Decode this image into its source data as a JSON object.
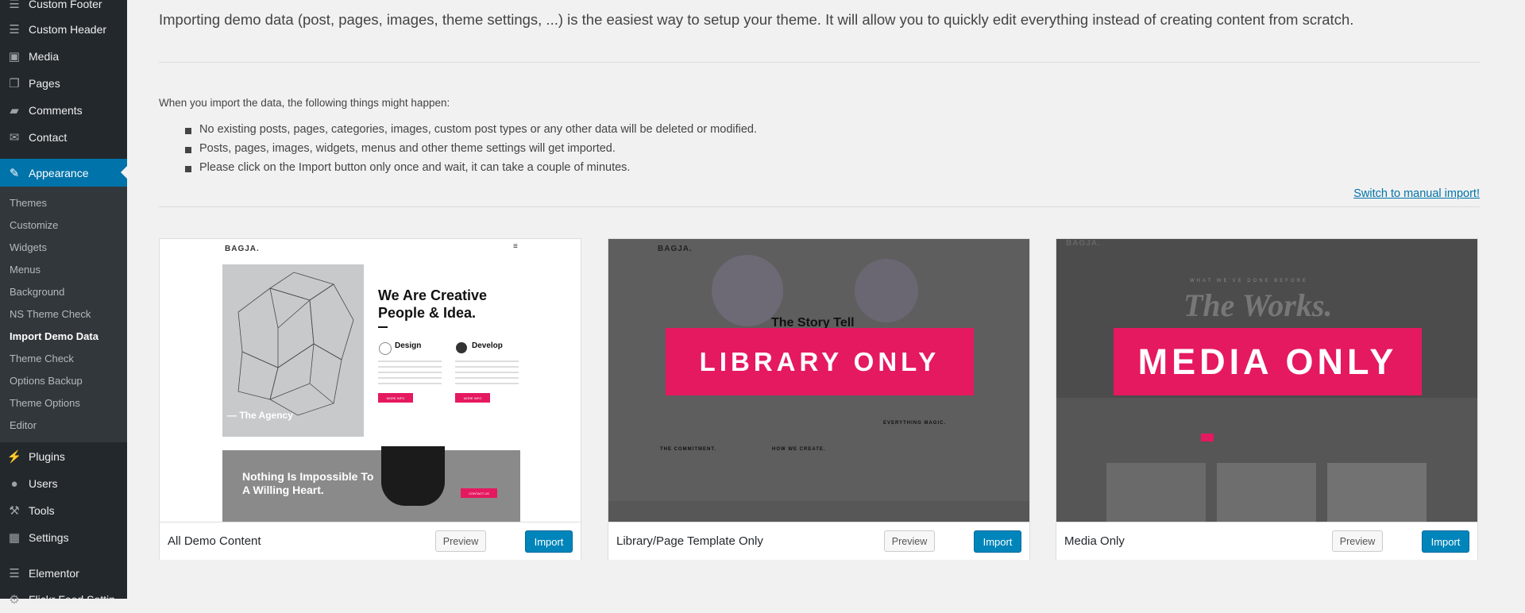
{
  "sidebar": {
    "items_top": [
      {
        "label": "Custom Footer",
        "icon": "menu-icon"
      },
      {
        "label": "Custom Header",
        "icon": "menu-icon"
      },
      {
        "label": "Media",
        "icon": "media-icon"
      },
      {
        "label": "Pages",
        "icon": "pages-icon"
      },
      {
        "label": "Comments",
        "icon": "comments-icon"
      },
      {
        "label": "Contact",
        "icon": "mail-icon"
      }
    ],
    "current": {
      "label": "Appearance",
      "icon": "paintbrush-icon"
    },
    "submenu": [
      "Themes",
      "Customize",
      "Widgets",
      "Menus",
      "Background",
      "NS Theme Check",
      "Import Demo Data",
      "Theme Check",
      "Options Backup",
      "Theme Options",
      "Editor"
    ],
    "submenu_active": "Import Demo Data",
    "items_bottom": [
      {
        "label": "Plugins",
        "icon": "plugins-icon"
      },
      {
        "label": "Users",
        "icon": "users-icon"
      },
      {
        "label": "Tools",
        "icon": "tools-icon"
      },
      {
        "label": "Settings",
        "icon": "settings-icon"
      },
      {
        "label": "Elementor",
        "icon": "elementor-icon"
      },
      {
        "label": "Flickr Feed Settin",
        "icon": "gear-icon"
      }
    ],
    "accent_color": "#0073aa"
  },
  "main": {
    "intro": "Importing demo data (post, pages, images, theme settings, ...) is the easiest way to setup your theme. It will allow you to quickly edit everything instead of creating content from scratch.",
    "happen_title": "When you import the data, the following things might happen:",
    "bullets": [
      "No existing posts, pages, categories, images, custom post types or any other data will be deleted or modified.",
      "Posts, pages, images, widgets, menus and other theme settings will get imported.",
      "Please click on the Import button only once and wait, it can take a couple of minutes."
    ],
    "switch_link": "Switch to manual import!"
  },
  "cards": [
    {
      "name": "All Demo Content",
      "preview": "Preview",
      "import": "Import",
      "thumb": {
        "logo": "BAGJA.",
        "title": "We Are Creative People & Idea.",
        "feature_1": "Design",
        "feature_2": "Develop",
        "button": "MORE INFO",
        "agency": "— The Agency",
        "banner": "Nothing Is Impossible To A Willing Heart.",
        "contact": "CONTACT US"
      }
    },
    {
      "name": "Library/Page Template Only",
      "preview": "Preview",
      "import": "Import",
      "thumb": {
        "logo": "BAGJA.",
        "label": "LIBRARY ONLY",
        "story": "The Story Tell",
        "col_1": "THE COMMITMENT.",
        "col_2": "HOW WE CREATE.",
        "col_3": "EVERYTHING MAGIC."
      }
    },
    {
      "name": "Media Only",
      "preview": "Preview",
      "import": "Import",
      "thumb": {
        "logo": "BAGJA.",
        "label": "MEDIA ONLY",
        "works": "The Works.",
        "tagline": "WHAT WE'VE DONE BEFORE"
      }
    }
  ],
  "colors": {
    "import_button": "#0085ba",
    "pink": "#e5195f"
  }
}
